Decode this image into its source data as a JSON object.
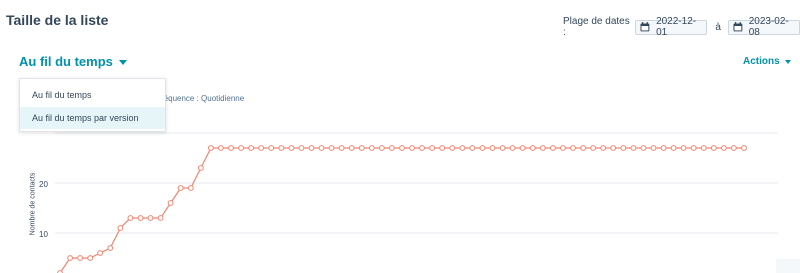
{
  "header": {
    "title": "Taille de la liste",
    "date_range_label": "Plage de dates :",
    "start_date": "2022-12-01",
    "to_label": "à",
    "end_date": "2023-02-08"
  },
  "view_selector": {
    "selected": "Au fil du temps",
    "options": [
      "Au fil du temps",
      "Au fil du temps par version"
    ],
    "highlighted_index": 1
  },
  "actions_label": "Actions",
  "frequency_text": "réquence : Quotidienne",
  "colors": {
    "accent": "#0091ae",
    "series": "#f2846f",
    "text": "#33475b"
  },
  "chart_data": {
    "type": "line",
    "ylabel": "Nombre de contacts",
    "yticks": [
      10,
      20
    ],
    "ylim": [
      0,
      30
    ],
    "series": [
      {
        "values": [
          2,
          5,
          5,
          5,
          6,
          7,
          11,
          13,
          13,
          13,
          13,
          16,
          19,
          19,
          23,
          27,
          27,
          27,
          27,
          27,
          27,
          27,
          27,
          27,
          27,
          27,
          27,
          27,
          27,
          27,
          27,
          27,
          27,
          27,
          27,
          27,
          27,
          27,
          27,
          27,
          27,
          27,
          27,
          27,
          27,
          27,
          27,
          27,
          27,
          27,
          27,
          27,
          27,
          27,
          27,
          27,
          27,
          27,
          27,
          27,
          27,
          27,
          27,
          27,
          27,
          27,
          27,
          27,
          27
        ]
      }
    ]
  }
}
